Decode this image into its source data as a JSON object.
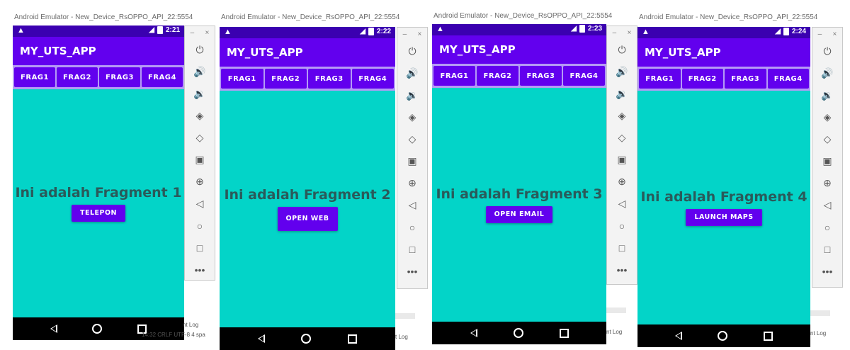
{
  "emulator_title": "Android Emulator - New_Device_RsOPPO_API_22:5554",
  "app_title": "MY_UTS_APP",
  "tabs": [
    "FRAG1",
    "FRAG2",
    "FRAG3",
    "FRAG4"
  ],
  "toolbar_icons": [
    "power-icon",
    "volume-up-icon",
    "volume-down-icon",
    "rotate-left-icon",
    "rotate-right-icon",
    "camera-icon",
    "zoom-icon",
    "back-icon",
    "home-icon",
    "overview-icon",
    "more-icon"
  ],
  "window_controls": {
    "minimize": "–",
    "close": "×"
  },
  "screens": [
    {
      "time": "2:21",
      "fragment_text": "Ini adalah Fragment 1",
      "button_label": "TELEPON"
    },
    {
      "time": "2:22",
      "fragment_text": "Ini adalah Fragment 2",
      "button_label": "OPEN WEB"
    },
    {
      "time": "2:23",
      "fragment_text": "Ini adalah Fragment 3",
      "button_label": "OPEN EMAIL"
    },
    {
      "time": "2:24",
      "fragment_text": "Ini adalah Fragment 4",
      "button_label": "LAUNCH MAPS"
    }
  ],
  "ide_fragments": {
    "status1": "14:32  CRLF  UTF-8  4 spa",
    "log1": "nt Log",
    "log2": "nt Log",
    "log3": "t Log",
    "log4": "nt Log"
  },
  "colors": {
    "primary": "#6200ee",
    "status_bar": "#3b00b0",
    "content_bg": "#03d4c8",
    "title_text": "#2a5a5a"
  }
}
